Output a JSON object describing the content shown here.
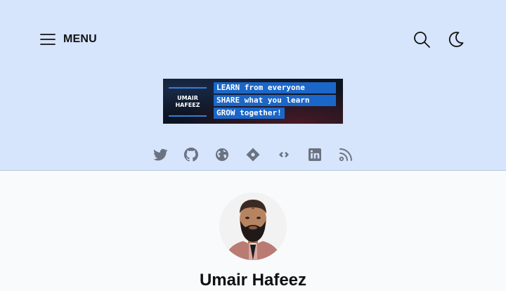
{
  "header": {
    "menu_label": "MENU",
    "menu_icon": "hamburger-icon",
    "search_icon": "search-icon",
    "theme_icon": "moon-icon",
    "background_color": "#d6e4fc"
  },
  "banner": {
    "logo_line1": "UMAIR",
    "logo_line2": "HAFEEZ",
    "lines": [
      "LEARN from everyone",
      "SHARE what you learn",
      "GROW together!"
    ],
    "accent_color": "#1b67c9"
  },
  "social": {
    "icons": [
      "twitter-icon",
      "github-icon",
      "globe-icon",
      "location-diamond-icon",
      "dev-link-icon",
      "linkedin-icon",
      "rss-icon"
    ],
    "icon_color": "#6b7280"
  },
  "author": {
    "name": "Umair Hafeez",
    "avatar_icon": "avatar-photo"
  }
}
